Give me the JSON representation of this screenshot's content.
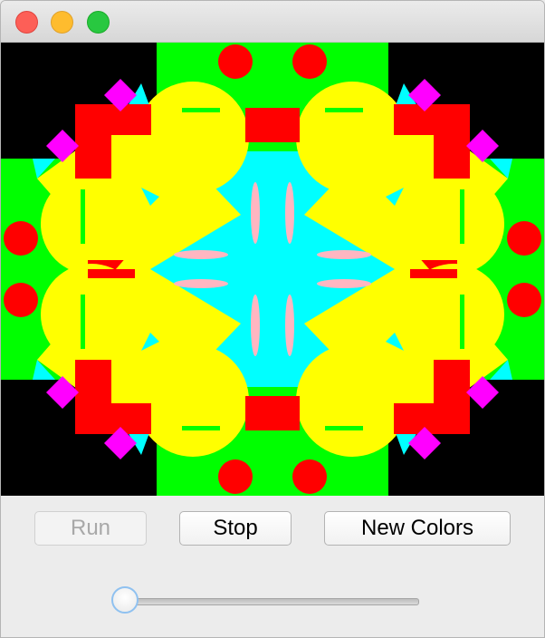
{
  "window": {
    "controls": [
      "close",
      "minimize",
      "zoom"
    ]
  },
  "canvas": {
    "colors": {
      "background": "#000000",
      "green": "#00ff00",
      "cyan": "#00ffff",
      "yellow": "#ffff00",
      "red": "#ff0000",
      "magenta": "#ff00ff",
      "pink": "#ffb6c1"
    }
  },
  "controls": {
    "run_label": "Run",
    "stop_label": "Stop",
    "new_colors_label": "New Colors"
  },
  "slider": {
    "value_fraction": 0.0
  }
}
